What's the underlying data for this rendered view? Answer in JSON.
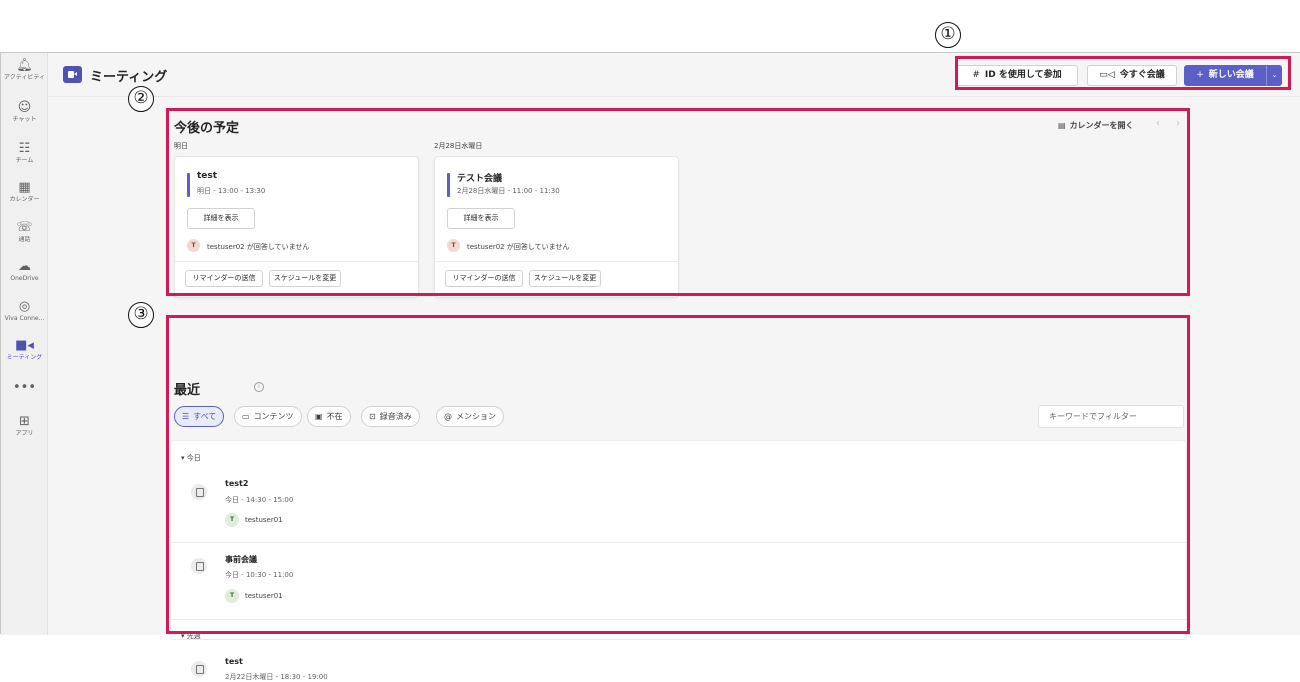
{
  "rail": [
    {
      "icon": "🔔︎",
      "label": "アクティビティ"
    },
    {
      "icon": "☺︎",
      "label": "チャット"
    },
    {
      "icon": "☷",
      "label": "チーム"
    },
    {
      "icon": "▦",
      "label": "カレンダー"
    },
    {
      "icon": "☏",
      "label": "通話"
    },
    {
      "icon": "☁︎",
      "label": "OneDrive"
    },
    {
      "icon": "◎",
      "label": "Viva Conne..."
    },
    {
      "icon": "■◂",
      "label": "ミーティング"
    },
    {
      "icon": "•••",
      "label": ""
    },
    {
      "icon": "⊞",
      "label": "アプリ"
    }
  ],
  "header": {
    "title": "ミーティング",
    "join_id": {
      "symbol": "#",
      "label": "ID を使用して参加"
    },
    "meet_now": {
      "symbol": "▭◁",
      "label": "今すぐ会議"
    },
    "new_meeting": {
      "symbol": "+",
      "label": "新しい会議"
    },
    "dropdown_symbol": "⌄"
  },
  "upcoming": {
    "title": "今後の予定",
    "open_calendar": "カレンダーを開く",
    "prev": "‹",
    "next": "›",
    "days": [
      {
        "label": "明日",
        "card": {
          "title": "test",
          "time": "明日 - 13:00 - 13:30",
          "details": "詳細を表示",
          "avatar": "T",
          "rsvp": "testuser02 が回答していません",
          "reminder": "リマインダーの送信",
          "reschedule": "スケジュールを変更"
        }
      },
      {
        "label": "2月28日水曜日",
        "card": {
          "title": "テスト会議",
          "time": "2月28日水曜日 - 11:00 - 11:30",
          "details": "詳細を表示",
          "avatar": "T",
          "rsvp": "testuser02 が回答していません",
          "reminder": "リマインダーの送信",
          "reschedule": "スケジュールを変更"
        }
      }
    ]
  },
  "recent": {
    "title": "最近",
    "info": "i",
    "filters": [
      {
        "icon": "☰",
        "label": "すべて"
      },
      {
        "icon": "▭",
        "label": "コンテンツ"
      },
      {
        "icon": "▣",
        "label": "不在"
      },
      {
        "icon": "⊡",
        "label": "録音済み"
      },
      {
        "icon": "@",
        "label": "メンション"
      }
    ],
    "search_placeholder": "キーワードでフィルター",
    "groups": [
      {
        "label": "▾ 今日"
      },
      {
        "label": "▾ 先週"
      }
    ],
    "meetings": [
      {
        "title": "test2",
        "time": "今日 - 14:30 - 15:00",
        "avatar": "T",
        "user": "testuser01"
      },
      {
        "title": "事前会議",
        "time": "今日 - 10:30 - 11:00",
        "avatar": "T",
        "user": "testuser01"
      },
      {
        "title": "test",
        "time": "2月22日木曜日 - 18:30 - 19:00"
      }
    ]
  },
  "annotations": {
    "one": "①",
    "two": "②",
    "three": "③",
    "color": "#d21a54"
  }
}
